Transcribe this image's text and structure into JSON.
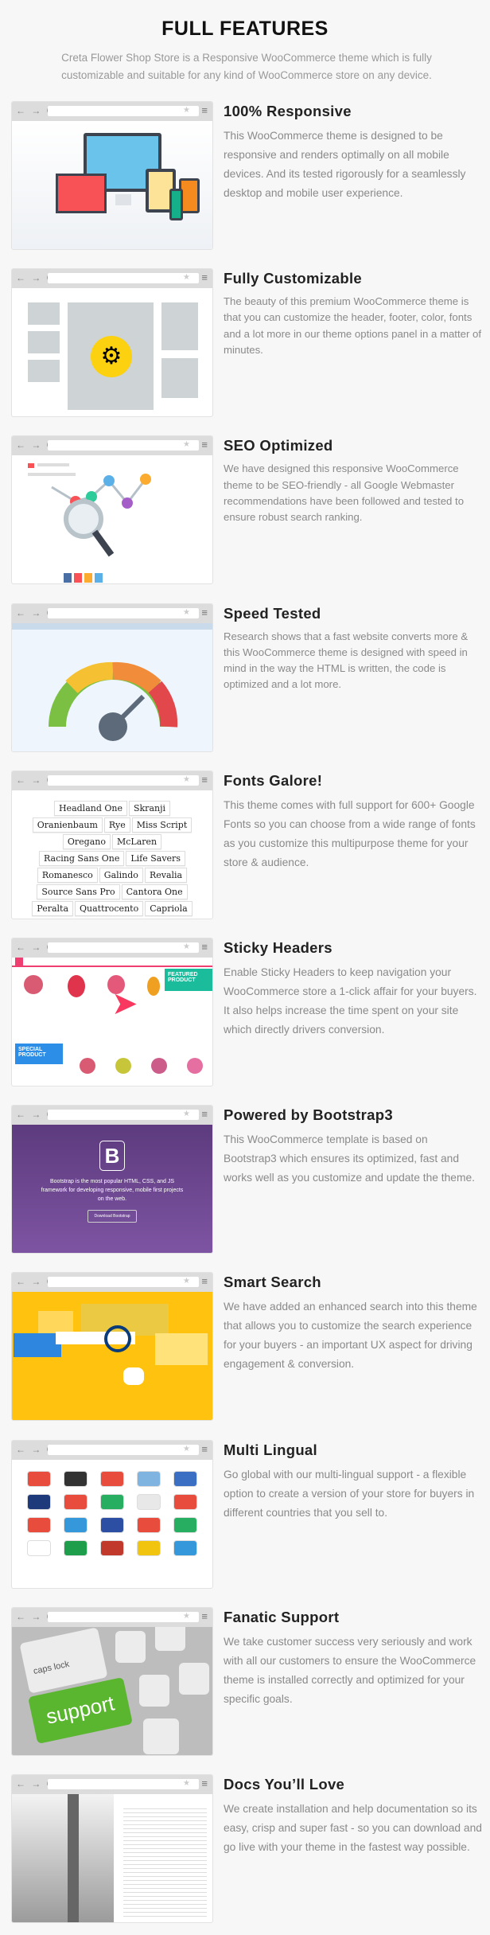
{
  "header": {
    "title": "FULL FEATURES",
    "intro": "Creta Flower Shop Store is a Responsive WooCommerce theme which is fully customizable and suitable for any kind of WooCommerce store on any device."
  },
  "browser": {
    "nav": "← → C",
    "star": "★",
    "menu": "≡"
  },
  "features": [
    {
      "title": "100% Responsive",
      "text": "This WooCommerce theme is designed to be responsive and renders optimally on all mobile devices. And its tested rigorously for a seamlessly desktop and mobile user experience."
    },
    {
      "title": "Fully Customizable",
      "text": "The beauty of this premium WooCommerce theme is that you can customize the header, footer, color, fonts and a lot more in our theme options panel in a matter of minutes."
    },
    {
      "title": "SEO Optimized",
      "text": "We have designed this responsive WooCommerce theme to be SEO-friendly - all Google Webmaster recommendations have been followed and tested to ensure robust search ranking."
    },
    {
      "title": "Speed Tested",
      "text": "Research shows that a fast website converts more & this WooCommerce theme is designed with speed in mind in the way the HTML is written, the code is optimized and a lot more."
    },
    {
      "title": "Fonts Galore!",
      "text": "This theme comes with full support for 600+ Google Fonts so you can choose from a wide range of fonts as you customize this multipurpose theme for your store & audience."
    },
    {
      "title": "Sticky Headers",
      "text": "Enable Sticky Headers to keep navigation your WooCommerce store a 1-click affair for your buyers. It also helps increase the time spent on your site which directly drivers conversion."
    },
    {
      "title": "Powered by Bootstrap3",
      "text": "This WooCommerce template is based on Bootstrap3 which ensures its optimized, fast and works well as you customize and update the theme."
    },
    {
      "title": "Smart Search",
      "text": "We have added an enhanced search into this theme that allows you to customize the search experience for your buyers - an important UX aspect for driving engagement & conversion."
    },
    {
      "title": "Multi Lingual",
      "text": "Go global with our multi-lingual support - a flexible option to create a version of your store for buyers in different countries that you sell to."
    },
    {
      "title": "Fanatic Support",
      "text": "We take customer success very seriously and work with all our customers to ensure the WooCommerce theme is installed correctly and optimized for your specific goals."
    },
    {
      "title": "Docs You’ll Love",
      "text": "We create installation and help documentation so its easy, crisp and super fast - so you can download and go live with your theme in the fastest way possible."
    }
  ],
  "fonts": [
    "Headland One",
    "Skranji",
    "Oranienbaum",
    "Rye",
    "Miss Script",
    "Oregano",
    "McLaren",
    "Racing Sans One",
    "Life Savers",
    "Romanesco",
    "Galindo",
    "Revalia",
    "Source Sans Pro",
    "Cantora One",
    "Peralta",
    "Quattrocento",
    "Capriola"
  ],
  "sticky": {
    "featured": "FEATURED PRODUCT",
    "special": "SPECIAL PRODUCT"
  },
  "bootstrap": {
    "logo": "B",
    "tagline": "Bootstrap is the most popular HTML, CSS, and JS framework for developing responsive, mobile first projects on the web.",
    "button": "Download Bootstrap"
  },
  "support": {
    "key": "support",
    "caps": "caps lock"
  },
  "flag_colors": [
    "#e74c3c",
    "#333333",
    "#e74c3c",
    "#7fb3e0",
    "#3a6fc4",
    "#1f3a7a",
    "#e74c3c",
    "#27ae60",
    "#e8e8e8",
    "#e74c3c",
    "#e74c3c",
    "#3498db",
    "#2c4fa3",
    "#e74c3c",
    "#27ae60",
    "#ffffff",
    "#1e9e4a",
    "#c0392b",
    "#f1c40f",
    "#3498db"
  ],
  "colors": {
    "accent_pink": "#ef3f70",
    "teal": "#1bbc9b",
    "bootstrap_purple": "#6b4a96",
    "search_yellow": "#ffc20e",
    "support_green": "#5ab52f"
  }
}
